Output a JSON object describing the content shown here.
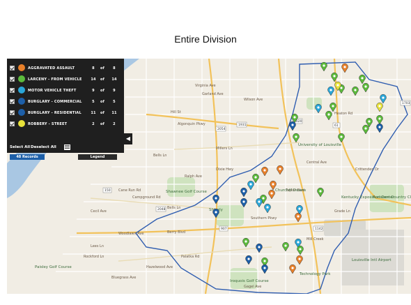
{
  "page": {
    "title": "Entire Division"
  },
  "layers": [
    {
      "name": "AGGRAVATED ASSAULT",
      "count": "8",
      "of": "of",
      "total": "8",
      "color": "#e8802a",
      "icon": "assault-pin-icon"
    },
    {
      "name": "LARCENY - FROM VEHICLE",
      "count": "14",
      "of": "of",
      "total": "14",
      "color": "#5cba3c",
      "icon": "larceny-pin-icon"
    },
    {
      "name": "MOTOR VEHICLE THEFT",
      "count": "9",
      "of": "of",
      "total": "9",
      "color": "#2aa6d8",
      "icon": "car-pin-icon"
    },
    {
      "name": "BURGLARY - COMMERCIAL",
      "count": "5",
      "of": "of",
      "total": "5",
      "color": "#1d5fa8",
      "icon": "building-pin-icon"
    },
    {
      "name": "BURGLARY - RESIDENTIAL",
      "count": "11",
      "of": "of",
      "total": "11",
      "color": "#1d5fa8",
      "icon": "house-pin-icon"
    },
    {
      "name": "ROBBERY - STREET",
      "count": "2",
      "of": "of",
      "total": "2",
      "color": "#e8e23a",
      "icon": "robbery-pin-icon"
    }
  ],
  "controls": {
    "select_all": "Select All",
    "deselect_all": "Deselect All",
    "records": "48 Records",
    "legend": "Legend"
  },
  "map": {
    "streets": [
      "Virginia Ave",
      "Garland Ave",
      "Hill St",
      "Algonquin Pkwy",
      "Millers Ln",
      "Bells Ln",
      "Ralph Ave",
      "Cane Run Rd",
      "Campground Rd",
      "Dixie Hwy",
      "Taylor Blvd",
      "Southern Pkwy",
      "Berry Blvd",
      "Woodlawn Ave",
      "Gagel Ave",
      "Wilson Ave",
      "Heaton Rd",
      "Palatka Rd",
      "Hazelwood Ave",
      "Bluegrass Ave",
      "Mill Creek",
      "Grade Ln",
      "Crittenden Dr",
      "Central Ave",
      "Cecil Ave",
      "Bells Ln",
      "Lees Ln",
      "Rockford Ln"
    ],
    "places": [
      "University of Louisville",
      "Churchill Downs",
      "Kentucky Exposition Center",
      "Shawnee Golf Course",
      "Audubon Country Club",
      "Louisville Intl Airport",
      "Iroquois Golf Course",
      "Technology Park",
      "Paisley Golf Course",
      "Shively"
    ],
    "routes": [
      "2054",
      "1020",
      "2048",
      "1931",
      "150",
      "61",
      "1865",
      "907",
      "1703",
      "1142"
    ],
    "colors": {
      "water": "#a9c7e3",
      "land": "#f1ede4",
      "park": "#cfe3bf",
      "boundary": "#2f5db0",
      "highway": "#f2c25a"
    }
  }
}
